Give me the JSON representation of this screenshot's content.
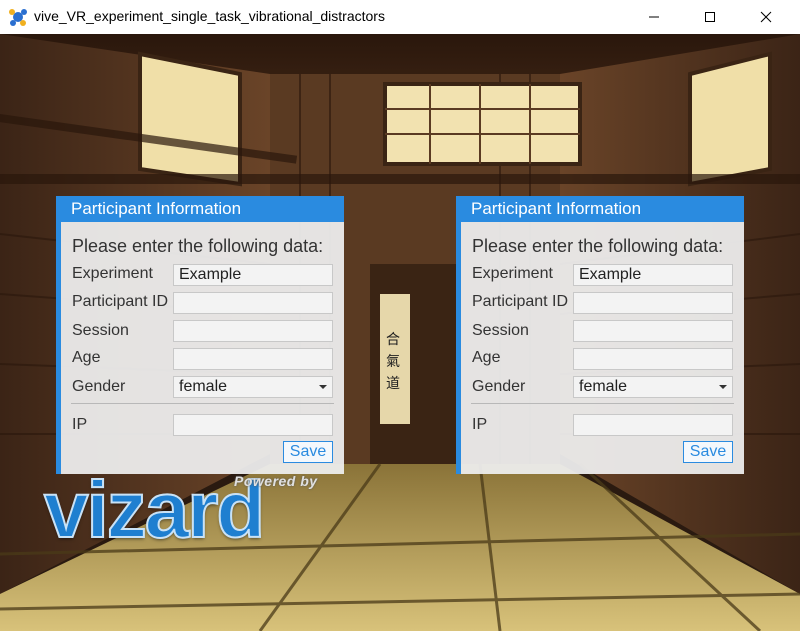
{
  "window": {
    "title": "vive_VR_experiment_single_task_vibrational_distractors",
    "icon": "vizard-app-icon",
    "buttons": {
      "minimize": "minimize-icon",
      "maximize": "maximize-icon",
      "close": "close-icon"
    }
  },
  "panels": [
    {
      "header": "Participant Information",
      "prompt": "Please enter the following data:",
      "fields": [
        {
          "label": "Experiment",
          "value": "Example"
        },
        {
          "label": "Participant ID",
          "value": ""
        },
        {
          "label": "Session",
          "value": ""
        },
        {
          "label": "Age",
          "value": ""
        },
        {
          "label": "Gender",
          "value": "female",
          "type": "select"
        }
      ],
      "ip": {
        "label": "IP",
        "value": ""
      },
      "save_label": "Save"
    },
    {
      "header": "Participant Information",
      "prompt": "Please enter the following data:",
      "fields": [
        {
          "label": "Experiment",
          "value": "Example"
        },
        {
          "label": "Participant ID",
          "value": ""
        },
        {
          "label": "Session",
          "value": ""
        },
        {
          "label": "Age",
          "value": ""
        },
        {
          "label": "Gender",
          "value": "female",
          "type": "select"
        }
      ],
      "ip": {
        "label": "IP",
        "value": ""
      },
      "save_label": "Save"
    }
  ],
  "logo": {
    "powered_by": "Powered by",
    "brand": "vizard"
  },
  "colors": {
    "accent": "#2a8be0",
    "panel_bg": "#eeeeee",
    "logo_blue": "#1f7fd0"
  }
}
